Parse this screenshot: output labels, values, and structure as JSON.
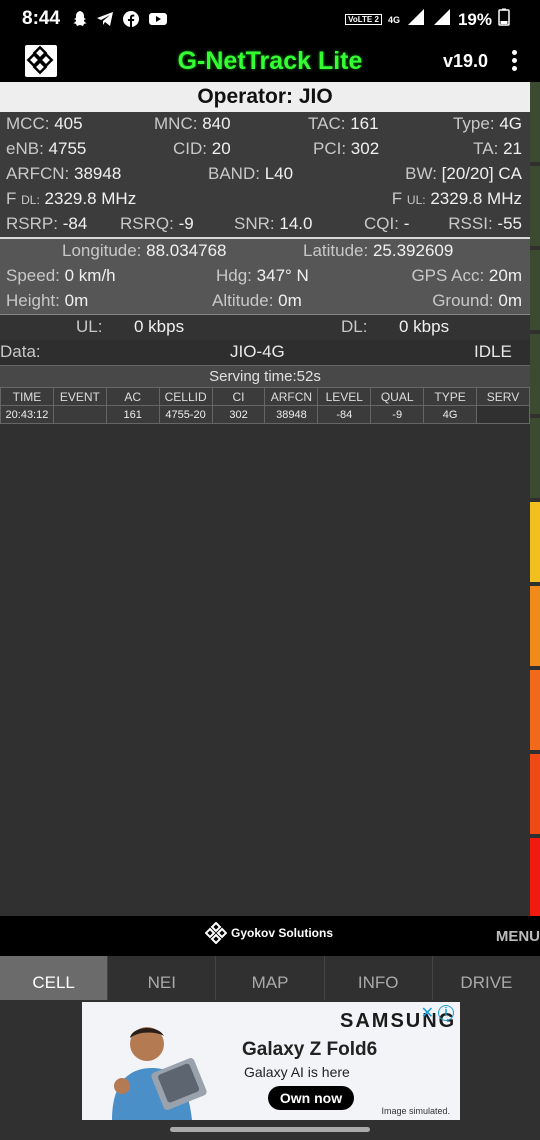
{
  "status_bar": {
    "time": "8:44",
    "network": "4G",
    "volte": "VoLTE 2",
    "battery": "19%"
  },
  "app": {
    "title": "G-NetTrack Lite",
    "version": "v19.0",
    "title_color": "#33ff33"
  },
  "operator": "Operator: JIO",
  "cell": {
    "mcc_label": "MCC:",
    "mcc": "405",
    "mnc_label": "MNC:",
    "mnc": "840",
    "tac_label": "TAC:",
    "tac": "161",
    "type_label": "Type:",
    "type": "4G",
    "enb_label": "eNB:",
    "enb": "4755",
    "cid_label": "CID:",
    "cid": "20",
    "pci_label": "PCI:",
    "pci": "302",
    "ta_label": "TA:",
    "ta": "21",
    "arfcn_label": "ARFCN:",
    "arfcn": "38948",
    "band_label": "BAND:",
    "band": "L40",
    "bw_label": "BW:",
    "bw": "[20/20] CA",
    "fdl_label": "F",
    "fdl_sub": "DL:",
    "fdl": "2329.8 MHz",
    "ful_label": "F",
    "ful_sub": "UL:",
    "ful": "2329.8 MHz",
    "rsrp_label": "RSRP:",
    "rsrp": "-84",
    "rsrq_label": "RSRQ:",
    "rsrq": "-9",
    "snr_label": "SNR:",
    "snr": "14.0",
    "cqi_label": "CQI:",
    "cqi": "-",
    "rssi_label": "RSSI:",
    "rssi": "-55"
  },
  "gps": {
    "lon_label": "Longitude:",
    "lon": "88.034768",
    "lat_label": "Latitude:",
    "lat": "25.392609",
    "speed_label": "Speed:",
    "speed": "0 km/h",
    "hdg_label": "Hdg:",
    "hdg": "347° N",
    "acc_label": "GPS Acc:",
    "acc": "20m",
    "height_label": "Height:",
    "height": "0m",
    "alt_label": "Altitude:",
    "alt": "0m",
    "ground_label": "Ground:",
    "ground": "0m"
  },
  "throughput": {
    "ul_label": "UL:",
    "ul": "0 kbps",
    "dl_label": "DL:",
    "dl": "0 kbps"
  },
  "data": {
    "label": "Data:",
    "network": "JIO-4G",
    "state": "IDLE"
  },
  "serving_time": "Serving time:52s",
  "log_table": {
    "headers": [
      "TIME",
      "EVENT",
      "AC",
      "CELLID",
      "CI",
      "ARFCN",
      "LEVEL",
      "QUAL",
      "TYPE",
      "SERV"
    ],
    "rows": [
      [
        "20:43:12",
        "",
        "161",
        "4755-20",
        "302",
        "38948",
        "-84",
        "-9",
        "4G",
        ""
      ]
    ]
  },
  "footer": {
    "brand": "Gyokov Solutions",
    "menu": "MENU"
  },
  "tabs": [
    "CELL",
    "NEI",
    "MAP",
    "INFO",
    "DRIVE"
  ],
  "active_tab": "CELL",
  "ad": {
    "brand": "SAMSUNG",
    "headline": "Galaxy Z Fold6",
    "sub": "Galaxy AI is here",
    "cta": "Own now",
    "disclaimer": "Image simulated."
  },
  "signal_bar_colors": [
    "#3d4a32",
    "#3d4a32",
    "#3d4a32",
    "#3d4a32",
    "#3d4a32",
    "#f0c020",
    "#f08a1a",
    "#f06a1a",
    "#f04a14",
    "#f01a10"
  ]
}
